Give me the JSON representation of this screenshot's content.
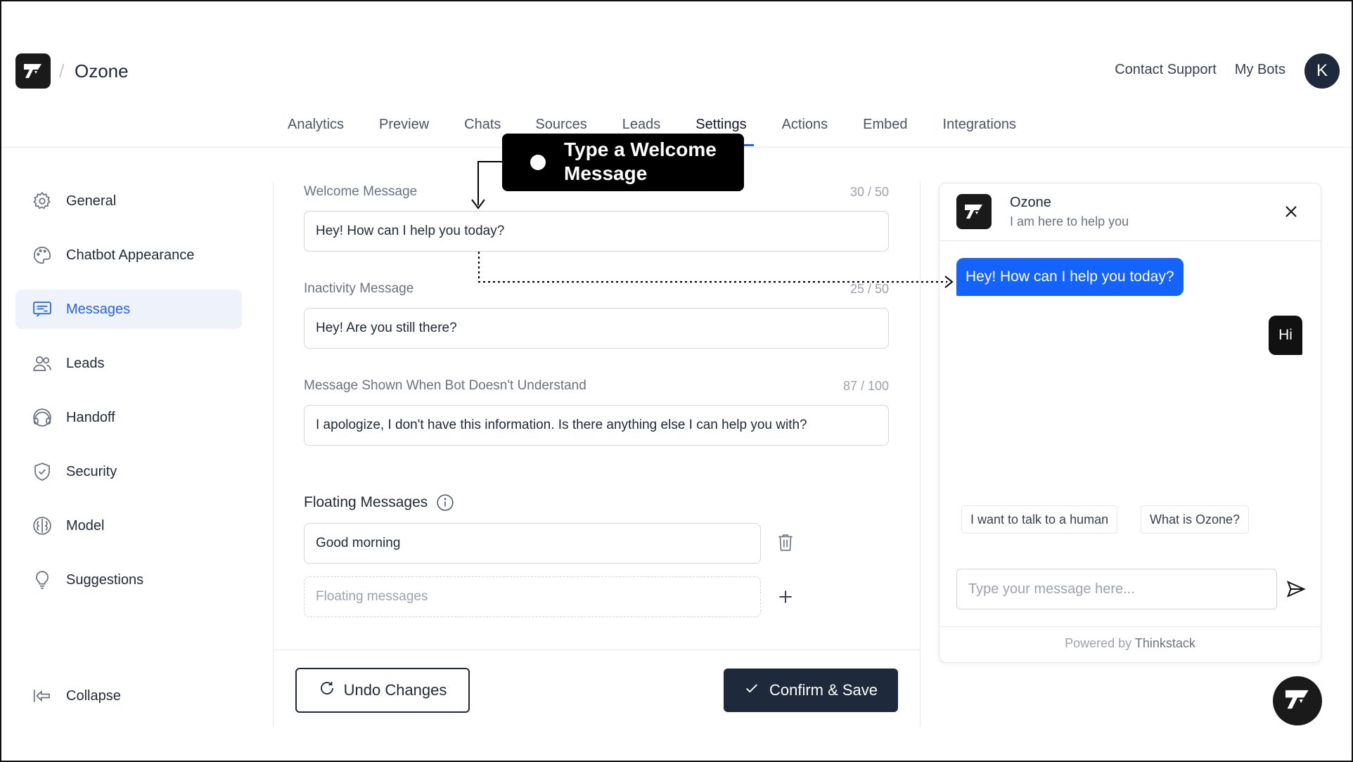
{
  "header": {
    "separator": "/",
    "app_title": "Ozone",
    "links": [
      "Contact Support",
      "My Bots"
    ],
    "avatar_initial": "K"
  },
  "tabs": [
    "Analytics",
    "Preview",
    "Chats",
    "Sources",
    "Leads",
    "Settings",
    "Actions",
    "Embed",
    "Integrations"
  ],
  "active_tab": "Settings",
  "sidebar": {
    "items": [
      {
        "label": "General",
        "icon": "gear-icon"
      },
      {
        "label": "Chatbot Appearance",
        "icon": "palette-icon"
      },
      {
        "label": "Messages",
        "icon": "messages-icon",
        "active": true
      },
      {
        "label": "Leads",
        "icon": "users-icon"
      },
      {
        "label": "Handoff",
        "icon": "headset-icon"
      },
      {
        "label": "Security",
        "icon": "shield-icon"
      },
      {
        "label": "Model",
        "icon": "brain-icon"
      },
      {
        "label": "Suggestions",
        "icon": "lightbulb-icon"
      }
    ],
    "collapse_label": "Collapse"
  },
  "form": {
    "welcome": {
      "label": "Welcome Message",
      "counter": "30 / 50",
      "value": "Hey! How can I help you today?"
    },
    "inactivity": {
      "label": "Inactivity Message",
      "counter": "25 / 50",
      "value": "Hey! Are you still there?"
    },
    "fallback": {
      "label": "Message Shown When Bot Doesn't Understand",
      "counter": "87 / 100",
      "value": "I apologize, I don't have this information. Is there anything else I can help you with?"
    },
    "floating": {
      "title": "Floating Messages",
      "items": [
        "Good morning"
      ],
      "placeholder": "Floating messages"
    }
  },
  "buttons": {
    "undo": "Undo Changes",
    "save": "Confirm & Save"
  },
  "tooltip": {
    "line1": "Type a Welcome",
    "line2": "Message"
  },
  "chat": {
    "name": "Ozone",
    "subtitle": "I am here to help you",
    "bot_message": "Hey! How can I help you today?",
    "user_message": "Hi",
    "suggestions": [
      "I want to talk to a human",
      "What is Ozone?"
    ],
    "input_placeholder": "Type your message here...",
    "powered_prefix": "Powered by",
    "powered_brand": "Thinkstack"
  },
  "colors": {
    "accent": "#2563eb",
    "bubble": "#1463ff",
    "dark": "#1e2a3b"
  }
}
